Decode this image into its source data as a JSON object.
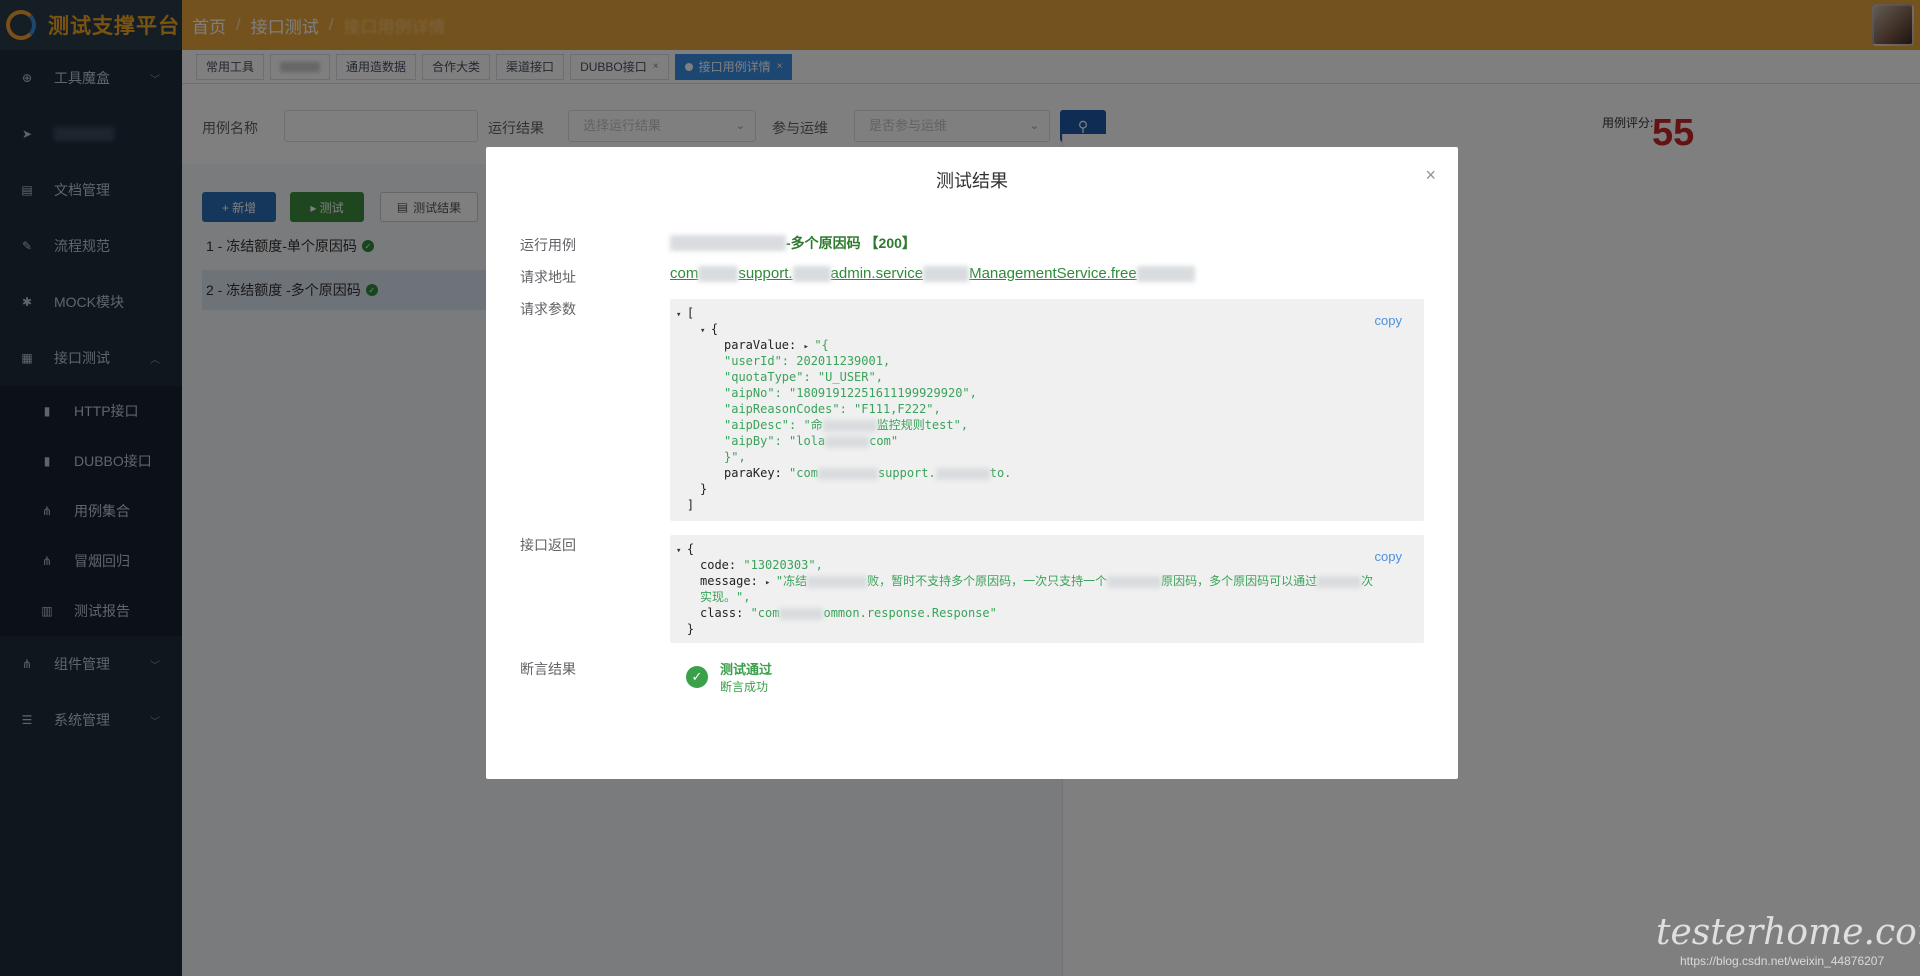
{
  "header": {
    "app_title": "测试支撑平台",
    "breadcrumb": [
      "首页",
      "接口测试"
    ],
    "breadcrumb_current": "接口用例详情"
  },
  "sidebar": {
    "items": [
      {
        "label": "工具魔盒",
        "icon": "crosshair-icon",
        "chevron": "﹀"
      },
      {
        "label": "",
        "icon": "send-icon",
        "blurred": true
      },
      {
        "label": "文档管理",
        "icon": "document-icon"
      },
      {
        "label": "流程规范",
        "icon": "edit-icon"
      },
      {
        "label": "MOCK模块",
        "icon": "bug-icon"
      },
      {
        "label": "接口测试",
        "icon": "grid-icon",
        "chevron": "︿"
      }
    ],
    "sub_items": [
      {
        "label": "HTTP接口",
        "icon": "info-icon"
      },
      {
        "label": "DUBBO接口",
        "icon": "info-icon"
      },
      {
        "label": "用例集合",
        "icon": "sitemap-icon"
      },
      {
        "label": "冒烟回归",
        "icon": "sitemap-icon"
      },
      {
        "label": "测试报告",
        "icon": "bar-chart-icon"
      }
    ],
    "bottom_items": [
      {
        "label": "组件管理",
        "icon": "sitemap-icon",
        "chevron": "﹀"
      },
      {
        "label": "系统管理",
        "icon": "list-icon",
        "chevron": "﹀"
      }
    ]
  },
  "tabs": [
    {
      "label": "常用工具"
    },
    {
      "label": "",
      "blurred": true
    },
    {
      "label": "通用造数据"
    },
    {
      "label": "合作大类"
    },
    {
      "label": "渠道接口"
    },
    {
      "label": "DUBBO接口",
      "closable": true
    },
    {
      "label": "接口用例详情",
      "closable": true,
      "active": true
    }
  ],
  "filters": {
    "case_name_label": "用例名称",
    "run_result_label": "运行结果",
    "run_result_placeholder": "选择运行结果",
    "ops_label": "参与运维",
    "ops_placeholder": "是否参与运维"
  },
  "actions": {
    "new_label": "+ 新增",
    "test_label": "▸ 测试",
    "result_label": "测试结果"
  },
  "cases": [
    {
      "label": "1 - 冻结额度-单个原因码"
    },
    {
      "label": "2 - 冻结额度 -多个原因码"
    }
  ],
  "score": {
    "label": "用例评分:",
    "value": "55"
  },
  "dialog": {
    "title": "测试结果",
    "close": "×",
    "labels": {
      "case": "运行用例",
      "url": "请求地址",
      "params": "请求参数",
      "response": "接口返回",
      "assert": "断言结果"
    },
    "case_value": "-多个原因码 【200】",
    "url_parts": [
      "com",
      "support.",
      "admin.service",
      "ManagementService.free"
    ],
    "copy": "copy",
    "params_lines": [
      {
        "indent": 0,
        "tri": "▾",
        "text": "["
      },
      {
        "indent": 1,
        "tri": "▾",
        "text": "{"
      },
      {
        "indent": 2,
        "key": "paraValue: ",
        "tri": "▸",
        "str": "\"{"
      },
      {
        "indent": 2,
        "str": "\"userId\": 202011239001,"
      },
      {
        "indent": 2,
        "str": "\"quotaType\": \"U_USER\","
      },
      {
        "indent": 2,
        "str": "\"aipNo\": \"18091912251611199929920\","
      },
      {
        "indent": 2,
        "str": "\"aipReasonCodes\": \"F111,F222\","
      },
      {
        "indent": 2,
        "str": "\"aipDesc\": \"命",
        "str2": "监控规则test\","
      },
      {
        "indent": 2,
        "str": "\"aipBy\": \"lola",
        "str2": "com\""
      },
      {
        "indent": 2,
        "str": "}\","
      },
      {
        "indent": 2,
        "key": "paraKey: ",
        "str": "\"com",
        "str2": "support.",
        "str3": "to."
      },
      {
        "indent": 1,
        "text": "}"
      },
      {
        "indent": 0,
        "text": "]"
      }
    ],
    "response_lines": [
      {
        "indent": 0,
        "tri": "▾",
        "text": "{"
      },
      {
        "indent": 1,
        "key": "code: ",
        "str": "\"13020303\","
      },
      {
        "indent": 1,
        "key": "message: ",
        "tri": "▸",
        "str": "\"冻结",
        "str2": "败，暂时不支持多个原因码，一次只支持一个",
        "str3": "原因码，多个原因码可以通过",
        "str4": "次"
      },
      {
        "indent": 1,
        "str": "实现。\","
      },
      {
        "indent": 1,
        "key": "class: ",
        "str": "\"com",
        "str2": "ommon.response.Response\""
      },
      {
        "indent": 0,
        "text": "}"
      }
    ],
    "assert_title": "测试通过",
    "assert_sub": "断言成功"
  },
  "watermark": {
    "text": "testerhome.com",
    "url": "https://blog.csdn.net/weixin_44876207"
  }
}
